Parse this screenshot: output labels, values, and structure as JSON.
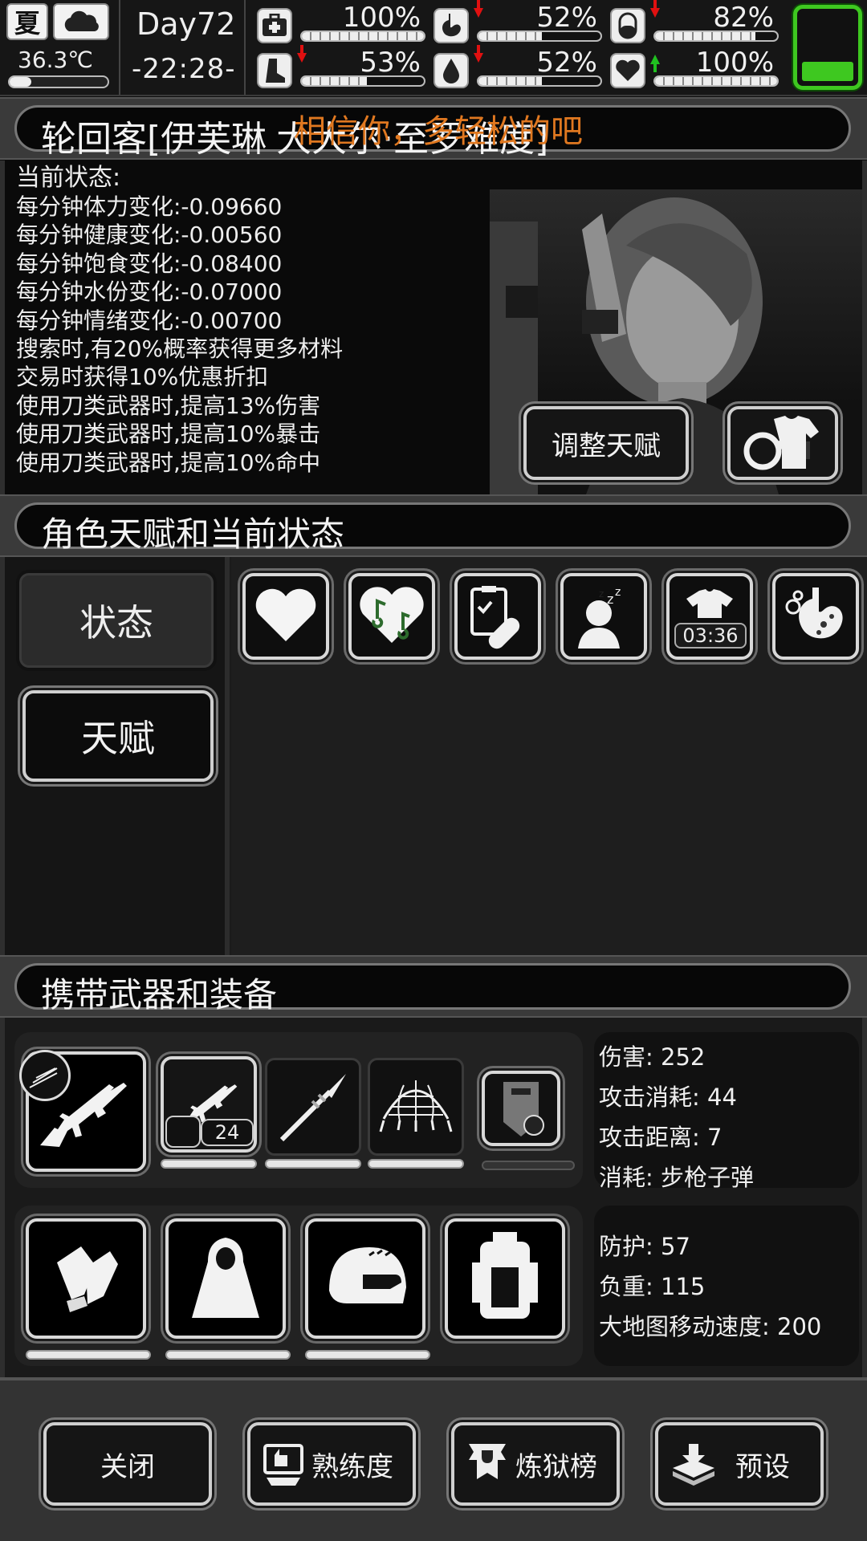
{
  "topbar": {
    "season": "夏",
    "temperature": "36.3℃",
    "day": "Day72",
    "time": "-22:28-",
    "stats": [
      {
        "icon": "first-aid-icon",
        "value": "100%",
        "fill": 1.0,
        "trend": "none"
      },
      {
        "icon": "stomach-icon",
        "value": "52%",
        "fill": 0.52,
        "trend": "down"
      },
      {
        "icon": "pill-icon",
        "value": "82%",
        "fill": 0.82,
        "trend": "down"
      },
      {
        "icon": "boot-icon",
        "value": "53%",
        "fill": 0.53,
        "trend": "down"
      },
      {
        "icon": "water-drop-icon",
        "value": "52%",
        "fill": 0.52,
        "trend": "down"
      },
      {
        "icon": "heart-icon",
        "value": "100%",
        "fill": 1.0,
        "trend": "up"
      }
    ],
    "battery_fill": 0.3,
    "battery_color": "#3ec820"
  },
  "character": {
    "title": "轮回客[伊芙琳",
    "title_rest": "大大尔·至罗难度]",
    "overlay": "相信你，多轻松的吧",
    "overlay_color": "#e07820",
    "status_heading": "当前状态:",
    "status_lines": [
      "每分钟体力变化:-0.09660",
      "每分钟健康变化:-0.00560",
      "每分钟饱食变化:-0.08400",
      "每分钟水份变化:-0.07000",
      "每分钟情绪变化:-0.00700",
      "搜索时,有20%概率获得更多材料",
      "交易时获得10%优惠折扣",
      "使用刀类武器时,提高13%伤害",
      "使用刀类武器时,提高10%暴击",
      "使用刀类武器时,提高10%命中"
    ],
    "adjust_talent_button": "调整天赋",
    "outfit_button_icon": "shirt-swap-icon"
  },
  "talents": {
    "header": "角色天赋和当前状态",
    "tabs": [
      {
        "label": "状态",
        "active": true
      },
      {
        "label": "天赋",
        "active": false
      }
    ],
    "status_icons": [
      {
        "icon": "heart-icon"
      },
      {
        "icon": "music-heart-icon"
      },
      {
        "icon": "clipboard-bandage-icon"
      },
      {
        "icon": "sleep-icon"
      },
      {
        "icon": "shirt-timer-icon",
        "timer": "03:36"
      },
      {
        "icon": "stomach-sick-icon"
      }
    ]
  },
  "equipment": {
    "header": "携带武器和装备",
    "main_weapon_icon": "assault-rifle-icon",
    "weapon_slots": [
      {
        "icon": "rifle-icon",
        "ammo": "24",
        "selected": true
      },
      {
        "icon": "spear-icon"
      },
      {
        "icon": "net-icon"
      },
      {
        "icon": "riot-shield-icon"
      }
    ],
    "weapon_stats": [
      "伤害: 252",
      "攻击消耗: 44",
      "攻击距离: 7",
      "消耗: 步枪子弹"
    ],
    "armor_slots": [
      {
        "icon": "gloves-icon"
      },
      {
        "icon": "cloak-icon"
      },
      {
        "icon": "helmet-icon"
      },
      {
        "icon": "backpack-icon"
      }
    ],
    "armor_stats": [
      "防护: 57",
      "负重: 115",
      "大地图移动速度: 200"
    ]
  },
  "footer": {
    "buttons": [
      {
        "label": "关闭",
        "icon": ""
      },
      {
        "label": "熟练度",
        "icon": "proficiency-icon"
      },
      {
        "label": "炼狱榜",
        "icon": "trophy-banner-icon"
      },
      {
        "label": "预设",
        "icon": "box-download-icon"
      }
    ]
  }
}
